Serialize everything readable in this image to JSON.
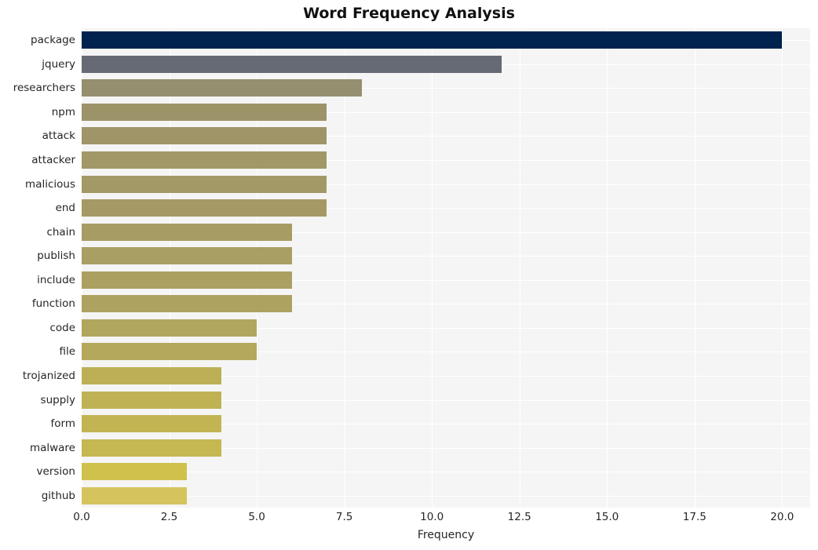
{
  "chart_data": {
    "type": "bar",
    "orientation": "horizontal",
    "title": "Word Frequency Analysis",
    "xlabel": "Frequency",
    "ylabel": "",
    "xlim": [
      0,
      20.8
    ],
    "xticks": [
      "0.0",
      "2.5",
      "5.0",
      "7.5",
      "10.0",
      "12.5",
      "15.0",
      "17.5",
      "20.0"
    ],
    "xtick_values": [
      0,
      2.5,
      5,
      7.5,
      10,
      12.5,
      15,
      17.5,
      20
    ],
    "grid": true,
    "legend": "none",
    "categories": [
      "package",
      "jquery",
      "researchers",
      "npm",
      "attack",
      "attacker",
      "malicious",
      "end",
      "chain",
      "publish",
      "include",
      "function",
      "code",
      "file",
      "trojanized",
      "supply",
      "form",
      "malware",
      "version",
      "github"
    ],
    "values": [
      20,
      12,
      8,
      7,
      7,
      7,
      7,
      7,
      6,
      6,
      6,
      6,
      5,
      5,
      4,
      4,
      4,
      4,
      3,
      3
    ],
    "colors": [
      "#00224e",
      "#656a74",
      "#958e6f",
      "#9d9369",
      "#9f9568",
      "#a19767",
      "#a39966",
      "#a59a65",
      "#a79c64",
      "#a99e63",
      "#aba062",
      "#ada260",
      "#b1a65d",
      "#b4a85c",
      "#bcb057",
      "#bfb255",
      "#c2b453",
      "#c5b752",
      "#cfc14c",
      "#d5c45e"
    ],
    "plot_background": "#f5f5f5",
    "grid_color": "#ffffff",
    "text_color": "#262626"
  }
}
